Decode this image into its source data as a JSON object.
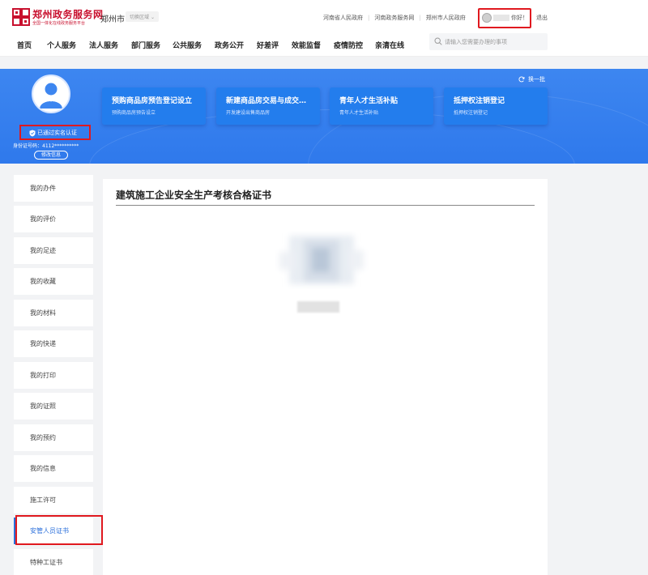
{
  "header": {
    "brand_title": "郑州政务服务网",
    "brand_subtitle": "全国一体化在线政务服务平台",
    "city": "郑州市",
    "switch_region": "切换区域",
    "top_links": [
      "河南省人民政府",
      "河南政务服务网",
      "郑州市人民政府"
    ],
    "user_greeting": "你好！",
    "logout": "退出"
  },
  "nav": {
    "items": [
      "首页",
      "个人服务",
      "法人服务",
      "部门服务",
      "公共服务",
      "政务公开",
      "好差评",
      "效能监督",
      "疫情防控",
      "亲清在线"
    ],
    "search_placeholder": "请输入您需要办理的事项"
  },
  "profile": {
    "verified_label": "已通过实名认证",
    "id_number": "身份证号码：4112**********",
    "edit_label": "修改信息",
    "refresh_label": "换一批"
  },
  "recommend_cards": [
    {
      "title": "预购商品房预告登记设立",
      "subtitle": "预购商品房预告设立"
    },
    {
      "title": "新建商品房交易与成交…",
      "subtitle": "开发建设出售商品房"
    },
    {
      "title": "青年人才生活补贴",
      "subtitle": "青年人才生活补贴"
    },
    {
      "title": "抵押权注销登记",
      "subtitle": "抵押权注销登记"
    }
  ],
  "sidebar": {
    "items": [
      {
        "label": "我的办件"
      },
      {
        "label": "我的评价"
      },
      {
        "label": "我的足迹"
      },
      {
        "label": "我的收藏"
      },
      {
        "label": "我的材料"
      },
      {
        "label": "我的快递"
      },
      {
        "label": "我的打印"
      },
      {
        "label": "我的证照"
      },
      {
        "label": "我的预约"
      },
      {
        "label": "我的信息"
      },
      {
        "label": "施工许可"
      },
      {
        "label": "安管人员证书",
        "active": true
      },
      {
        "label": "特种工证书"
      }
    ]
  },
  "main": {
    "title": "建筑施工企业安全生产考核合格证书"
  },
  "colors": {
    "brand_red": "#c8102e",
    "banner_blue": "#3d86f0",
    "card_blue": "#237ded",
    "active_blue": "#2a6fdb",
    "highlight_red": "#e0191f"
  }
}
